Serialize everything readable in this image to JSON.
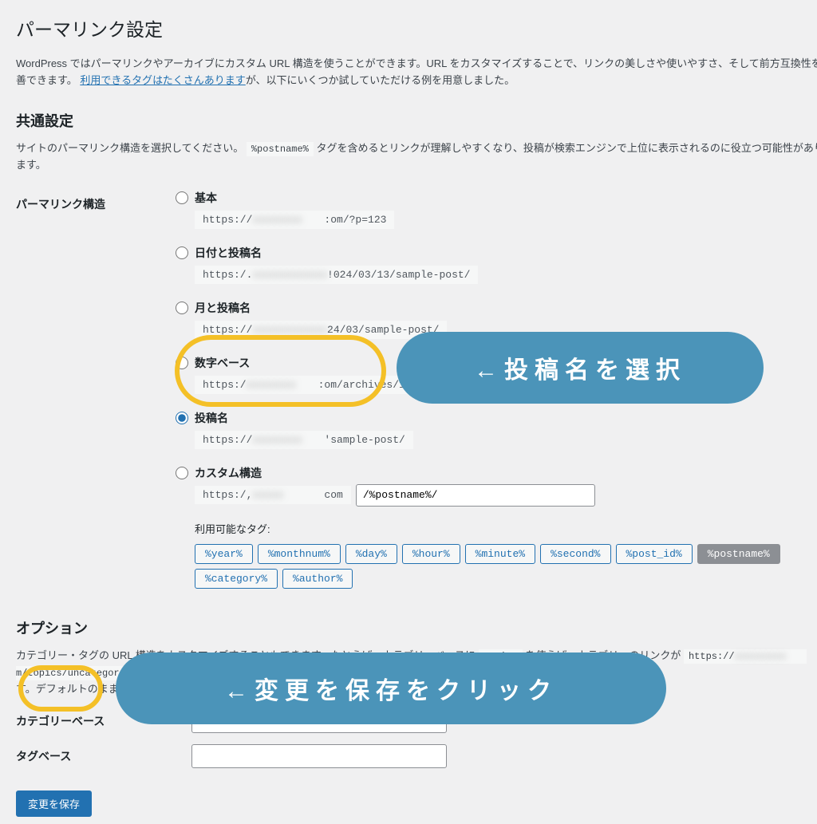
{
  "page": {
    "title": "パーマリンク設定",
    "intro_prefix": "WordPress ではパーマリンクやアーカイブにカスタム URL 構造を使うことができます。URL をカスタマイズすることで、リンクの美しさや使いやすさ、そして前方互換性を改善できます。",
    "intro_link": "利用できるタグはたくさんあります",
    "intro_suffix": "が、以下にいくつか試していただける例を用意しました。"
  },
  "common": {
    "heading": "共通設定",
    "desc_prefix": "サイトのパーマリンク構造を選択してください。",
    "desc_code": "%postname%",
    "desc_suffix": " タグを含めるとリンクが理解しやすくなり、投稿が検索エンジンで上位に表示されるのに役立つ可能性があります。"
  },
  "structure": {
    "row_label": "パーマリンク構造",
    "options": {
      "plain": {
        "label": "基本",
        "url_proto": "https://",
        "url_path": ":om/?p=123"
      },
      "date": {
        "label": "日付と投稿名",
        "url_proto": "https:/.",
        "url_path": "!024/03/13/sample-post/"
      },
      "month": {
        "label": "月と投稿名",
        "url_proto": "https://",
        "url_path": "24/03/sample-post/"
      },
      "numeric": {
        "label": "数字ベース",
        "url_proto": "https:/",
        "url_path": ":om/archives/123"
      },
      "postname": {
        "label": "投稿名",
        "url_proto": "https://",
        "url_path": "'sample-post/"
      },
      "custom": {
        "label": "カスタム構造",
        "url_proto": "https:/,",
        "url_tld": "com",
        "value": "/%postname%/"
      }
    },
    "tags_label": "利用可能なタグ:",
    "tags": [
      "%year%",
      "%monthnum%",
      "%day%",
      "%hour%",
      "%minute%",
      "%second%",
      "%post_id%",
      "%postname%",
      "%category%",
      "%author%"
    ],
    "active_tag": "%postname%"
  },
  "optional": {
    "heading": "オプション",
    "desc_prefix": "カテゴリー・タグの URL 構造をカスタマイズすることもできます。たとえば、カテゴリーベースに ",
    "desc_code1": "topics",
    "desc_mid": " を使えば、カテゴリーのリンクが ",
    "desc_code2_a": "https://",
    "desc_code2_b": "m/topics/uncategorize",
    "desc_suffix": "す。デフォルトのままにしたければ空欄にしてください。",
    "category_label": "カテゴリーベース",
    "tag_label": "タグベース",
    "category_value": "",
    "tag_value": ""
  },
  "submit": {
    "label": "変更を保存"
  },
  "annotations": {
    "callout1": "←投稿名を選択",
    "callout2": "←変更を保存をクリック"
  }
}
